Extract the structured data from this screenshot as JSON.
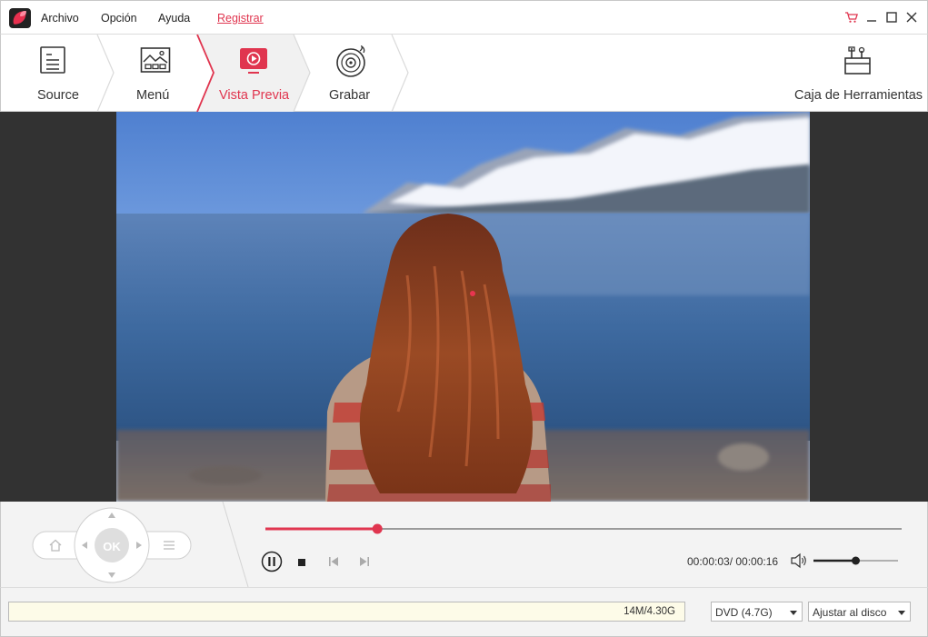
{
  "menu": {
    "items": [
      "Archivo",
      "Opción",
      "Ayuda"
    ],
    "register_label": "Registrar"
  },
  "window_controls": [
    "cart-icon",
    "minimize-icon",
    "maximize-icon",
    "close-icon"
  ],
  "steps": [
    {
      "label": "Source",
      "icon": "source-document-icon",
      "active": false
    },
    {
      "label": "Menú",
      "icon": "menu-image-icon",
      "active": false
    },
    {
      "label": "Vista Previa",
      "icon": "preview-play-icon",
      "active": true
    },
    {
      "label": "Grabar",
      "icon": "burn-disc-icon",
      "active": false
    }
  ],
  "toolbox_label": "Caja de Herramientas",
  "remote": {
    "ok_label": "OK",
    "home_icon": "home-icon",
    "menu_icon": "list-icon"
  },
  "playback": {
    "progress_fraction": 0.176,
    "time_display": "00:00:03/ 00:00:16",
    "volume_fraction": 0.5
  },
  "capacity_text": "14M/4.30G",
  "disc_type": {
    "selected": "DVD (4.7G)"
  },
  "fit_mode": {
    "selected": "Ajustar al disco"
  },
  "colors": {
    "accent": "#e0354f",
    "panel": "#f3f3f3",
    "preview_bg": "#323232"
  }
}
